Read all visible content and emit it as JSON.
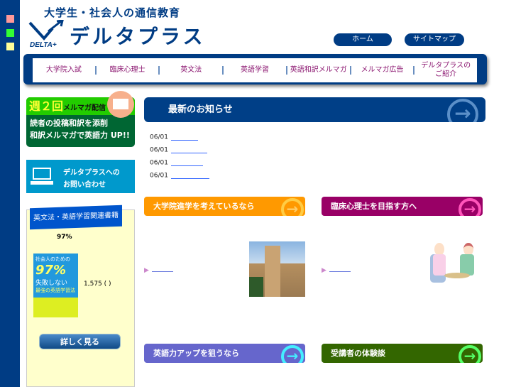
{
  "header": {
    "tagline": "大学生・社会人の通信教育",
    "brand": "デルタプラス",
    "logo_text": "DELTA+",
    "home": "ホーム",
    "sitemap": "サイトマップ"
  },
  "nav": [
    "大学院入試",
    "臨床心理士",
    "英文法",
    "英語学習",
    "英語和訳メルマガ",
    "メルマガ広告",
    "デルタプラスの\nご紹介"
  ],
  "sidebar": {
    "mail": {
      "big": "週２回",
      "small": "メルマガ配信",
      "line1": "読者の投稿和訳を添削",
      "line2": "和訳メルマガで英語力 UP!!"
    },
    "contact": {
      "line1": "デルタプラスへの",
      "line2": "お問い合わせ"
    },
    "books": {
      "title": "英文法・英語学習関連書籍",
      "subtitle": "97%",
      "book_cover": {
        "top": "社会人のための",
        "big": "97%",
        "mid": "失敗しない",
        "bottom": "最強の英語学習法"
      },
      "price": "1,575 ( )",
      "details": "詳しく見る"
    }
  },
  "main": {
    "news_title": "最新のお知らせ",
    "news": [
      {
        "date": "06/01"
      },
      {
        "date": "06/01"
      },
      {
        "date": "06/01"
      },
      {
        "date": "06/01"
      }
    ],
    "sections": [
      {
        "title": "大学院進学を考えているなら",
        "color": "#ff9900"
      },
      {
        "title": "臨床心理士を目指す方へ",
        "color": "#990066"
      },
      {
        "title": "英語力アップを狙うなら",
        "color": "#6666cc"
      },
      {
        "title": "受講者の体験談",
        "color": "#336600"
      }
    ]
  }
}
